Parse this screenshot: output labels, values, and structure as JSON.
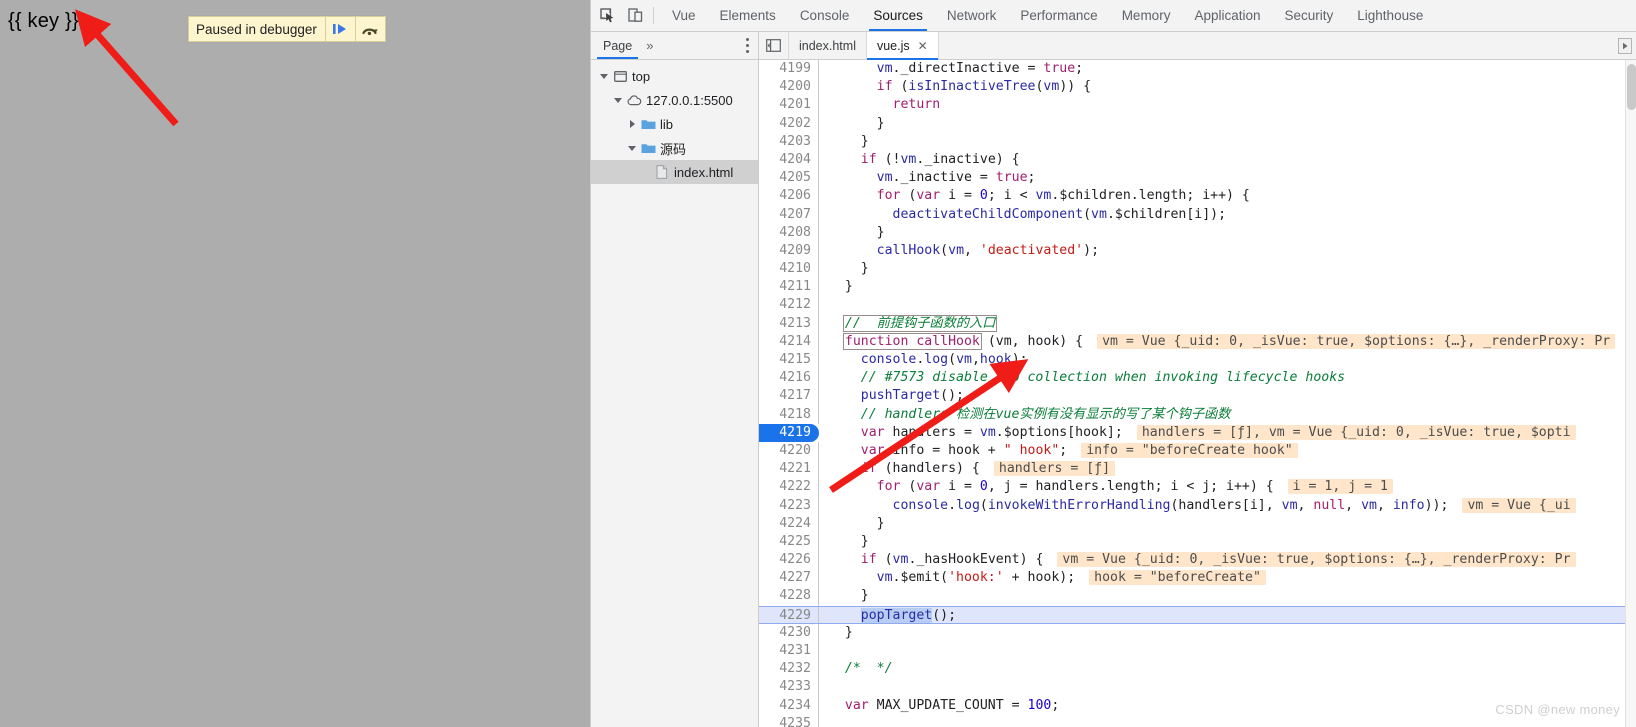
{
  "theme": {
    "accent": "#1a73e8",
    "banner_bg": "#fdf5cd",
    "inline_value_bg": "#ffe5c9",
    "exec_line_bg": "#dfe6fb"
  },
  "page": {
    "body_text": "{{ key }}",
    "paused_banner": {
      "text": "Paused in debugger",
      "resume_icon": "resume-script-icon",
      "step_over_icon": "step-over-icon"
    }
  },
  "devtools": {
    "toolbar_icons": [
      {
        "name": "inspect-element-icon"
      },
      {
        "name": "device-toolbar-icon"
      }
    ],
    "tabs": [
      {
        "label": "Vue",
        "selected": false
      },
      {
        "label": "Elements",
        "selected": false
      },
      {
        "label": "Console",
        "selected": false
      },
      {
        "label": "Sources",
        "selected": true
      },
      {
        "label": "Network",
        "selected": false
      },
      {
        "label": "Performance",
        "selected": false
      },
      {
        "label": "Memory",
        "selected": false
      },
      {
        "label": "Application",
        "selected": false
      },
      {
        "label": "Security",
        "selected": false
      },
      {
        "label": "Lighthouse",
        "selected": false
      }
    ],
    "navigator": {
      "tabs": [
        {
          "label": "Page",
          "selected": true
        }
      ],
      "more_label": "»",
      "tree": [
        {
          "label": "top",
          "depth": 0,
          "icon": "frame-icon",
          "arrow": "open",
          "selected": false
        },
        {
          "label": "127.0.0.1:5500",
          "depth": 1,
          "icon": "cloud-icon",
          "arrow": "open",
          "selected": false
        },
        {
          "label": "lib",
          "depth": 2,
          "icon": "folder-icon",
          "arrow": "closed",
          "selected": false
        },
        {
          "label": "源码",
          "depth": 2,
          "icon": "folder-icon",
          "arrow": "open",
          "selected": false
        },
        {
          "label": "index.html",
          "depth": 3,
          "icon": "file-icon",
          "arrow": "none",
          "selected": true
        }
      ]
    },
    "editor_tabs": [
      {
        "label": "index.html",
        "selected": false,
        "closable": false
      },
      {
        "label": "vue.js",
        "selected": true,
        "closable": true,
        "close_label": "✕"
      }
    ],
    "panel_toggle_icon": "show-navigator-icon",
    "tab_scroll_icon": "scroll-tabs-right-icon"
  },
  "code": {
    "first_line": 4199,
    "execution_line": 4219,
    "current_highlight_line": 4229,
    "lines": [
      {
        "n": 4199,
        "tokens": [
          {
            "t": "      ",
            "c": "pl"
          },
          {
            "t": "vm",
            "c": "nm"
          },
          {
            "t": "._directInactive = ",
            "c": "pl"
          },
          {
            "t": "true",
            "c": "kw"
          },
          {
            "t": ";",
            "c": "pl"
          }
        ]
      },
      {
        "n": 4200,
        "tokens": [
          {
            "t": "      ",
            "c": "pl"
          },
          {
            "t": "if",
            "c": "kw"
          },
          {
            "t": " (",
            "c": "pl"
          },
          {
            "t": "isInInactiveTree",
            "c": "fn"
          },
          {
            "t": "(",
            "c": "pl"
          },
          {
            "t": "vm",
            "c": "nm"
          },
          {
            "t": ")) {",
            "c": "pl"
          }
        ]
      },
      {
        "n": 4201,
        "tokens": [
          {
            "t": "        ",
            "c": "pl"
          },
          {
            "t": "return",
            "c": "kw"
          }
        ]
      },
      {
        "n": 4202,
        "tokens": [
          {
            "t": "      }",
            "c": "pl"
          }
        ]
      },
      {
        "n": 4203,
        "tokens": [
          {
            "t": "    }",
            "c": "pl"
          }
        ]
      },
      {
        "n": 4204,
        "tokens": [
          {
            "t": "    ",
            "c": "pl"
          },
          {
            "t": "if",
            "c": "kw"
          },
          {
            "t": " (!",
            "c": "pl"
          },
          {
            "t": "vm",
            "c": "nm"
          },
          {
            "t": "._inactive) {",
            "c": "pl"
          }
        ]
      },
      {
        "n": 4205,
        "tokens": [
          {
            "t": "      ",
            "c": "pl"
          },
          {
            "t": "vm",
            "c": "nm"
          },
          {
            "t": "._inactive = ",
            "c": "pl"
          },
          {
            "t": "true",
            "c": "kw"
          },
          {
            "t": ";",
            "c": "pl"
          }
        ]
      },
      {
        "n": 4206,
        "tokens": [
          {
            "t": "      ",
            "c": "pl"
          },
          {
            "t": "for",
            "c": "kw"
          },
          {
            "t": " (",
            "c": "pl"
          },
          {
            "t": "var",
            "c": "kw"
          },
          {
            "t": " i = ",
            "c": "pl"
          },
          {
            "t": "0",
            "c": "num"
          },
          {
            "t": "; i < ",
            "c": "pl"
          },
          {
            "t": "vm",
            "c": "nm"
          },
          {
            "t": ".$children.length; i++) {",
            "c": "pl"
          }
        ]
      },
      {
        "n": 4207,
        "tokens": [
          {
            "t": "        ",
            "c": "pl"
          },
          {
            "t": "deactivateChildComponent",
            "c": "fn"
          },
          {
            "t": "(",
            "c": "pl"
          },
          {
            "t": "vm",
            "c": "nm"
          },
          {
            "t": ".$children[i]);",
            "c": "pl"
          }
        ]
      },
      {
        "n": 4208,
        "tokens": [
          {
            "t": "      }",
            "c": "pl"
          }
        ]
      },
      {
        "n": 4209,
        "tokens": [
          {
            "t": "      ",
            "c": "pl"
          },
          {
            "t": "callHook",
            "c": "fn"
          },
          {
            "t": "(",
            "c": "pl"
          },
          {
            "t": "vm",
            "c": "nm"
          },
          {
            "t": ", ",
            "c": "pl"
          },
          {
            "t": "'deactivated'",
            "c": "str"
          },
          {
            "t": ");",
            "c": "pl"
          }
        ]
      },
      {
        "n": 4210,
        "tokens": [
          {
            "t": "    }",
            "c": "pl"
          }
        ]
      },
      {
        "n": 4211,
        "tokens": [
          {
            "t": "  }",
            "c": "pl"
          }
        ]
      },
      {
        "n": 4212,
        "tokens": []
      },
      {
        "n": 4213,
        "tokens": [
          {
            "t": "  ",
            "c": "pl"
          },
          {
            "t": "//  前提钩子函数的入口",
            "c": "cm",
            "box": true
          }
        ]
      },
      {
        "n": 4214,
        "tokens": [
          {
            "t": "  ",
            "c": "pl"
          },
          {
            "t": "function callHook",
            "c": "kw",
            "box": true
          },
          {
            "t": " (vm, hook) {",
            "c": "pl"
          }
        ],
        "inline": "vm = Vue {_uid: 0, _isVue: true, $options: {…}, _renderProxy: Pr"
      },
      {
        "n": 4215,
        "tokens": [
          {
            "t": "    ",
            "c": "pl"
          },
          {
            "t": "console",
            "c": "nm"
          },
          {
            "t": ".",
            "c": "pl"
          },
          {
            "t": "log",
            "c": "fn"
          },
          {
            "t": "(",
            "c": "pl"
          },
          {
            "t": "vm",
            "c": "nm"
          },
          {
            "t": ",",
            "c": "pl"
          },
          {
            "t": "hook",
            "c": "nm"
          },
          {
            "t": ");",
            "c": "pl"
          }
        ]
      },
      {
        "n": 4216,
        "tokens": [
          {
            "t": "    ",
            "c": "pl"
          },
          {
            "t": "// #7573 disable dep collection when invoking lifecycle hooks",
            "c": "cm"
          }
        ]
      },
      {
        "n": 4217,
        "tokens": [
          {
            "t": "    ",
            "c": "pl"
          },
          {
            "t": "pushTarget",
            "c": "fn"
          },
          {
            "t": "();",
            "c": "pl"
          }
        ]
      },
      {
        "n": 4218,
        "tokens": [
          {
            "t": "    ",
            "c": "pl"
          },
          {
            "t": "// handlers 检测在vue实例有没有显示的写了某个钩子函数",
            "c": "cm"
          }
        ]
      },
      {
        "n": 4219,
        "tokens": [
          {
            "t": "    ",
            "c": "pl"
          },
          {
            "t": "var",
            "c": "kw"
          },
          {
            "t": " handlers = ",
            "c": "pl"
          },
          {
            "t": "vm",
            "c": "nm"
          },
          {
            "t": ".$options[hook];",
            "c": "pl"
          }
        ],
        "inline": "handlers = [ƒ], vm = Vue {_uid: 0, _isVue: true, $opti"
      },
      {
        "n": 4220,
        "tokens": [
          {
            "t": "    ",
            "c": "pl"
          },
          {
            "t": "var",
            "c": "kw"
          },
          {
            "t": " info = hook + ",
            "c": "pl"
          },
          {
            "t": "\" hook\"",
            "c": "str"
          },
          {
            "t": ";",
            "c": "pl"
          }
        ],
        "inline": "info = \"beforeCreate hook\""
      },
      {
        "n": 4221,
        "tokens": [
          {
            "t": "    ",
            "c": "pl"
          },
          {
            "t": "if",
            "c": "kw"
          },
          {
            "t": " (handlers) {",
            "c": "pl"
          }
        ],
        "inline": "handlers = [ƒ]"
      },
      {
        "n": 4222,
        "tokens": [
          {
            "t": "      ",
            "c": "pl"
          },
          {
            "t": "for",
            "c": "kw"
          },
          {
            "t": " (",
            "c": "pl"
          },
          {
            "t": "var",
            "c": "kw"
          },
          {
            "t": " i = ",
            "c": "pl"
          },
          {
            "t": "0",
            "c": "num"
          },
          {
            "t": ", j = handlers.length; i < j; i++) {",
            "c": "pl"
          }
        ],
        "inline": "i = 1, j = 1"
      },
      {
        "n": 4223,
        "tokens": [
          {
            "t": "        ",
            "c": "pl"
          },
          {
            "t": "console",
            "c": "nm"
          },
          {
            "t": ".",
            "c": "pl"
          },
          {
            "t": "log",
            "c": "fn"
          },
          {
            "t": "(",
            "c": "pl"
          },
          {
            "t": "invokeWithErrorHandling",
            "c": "fn"
          },
          {
            "t": "(handlers[i], ",
            "c": "pl"
          },
          {
            "t": "vm",
            "c": "nm"
          },
          {
            "t": ", ",
            "c": "pl"
          },
          {
            "t": "null",
            "c": "kw"
          },
          {
            "t": ", ",
            "c": "pl"
          },
          {
            "t": "vm",
            "c": "nm"
          },
          {
            "t": ", ",
            "c": "pl"
          },
          {
            "t": "info",
            "c": "nm"
          },
          {
            "t": "));",
            "c": "pl"
          }
        ],
        "inline": "vm = Vue {_ui"
      },
      {
        "n": 4224,
        "tokens": [
          {
            "t": "      }",
            "c": "pl"
          }
        ]
      },
      {
        "n": 4225,
        "tokens": [
          {
            "t": "    }",
            "c": "pl"
          }
        ]
      },
      {
        "n": 4226,
        "tokens": [
          {
            "t": "    ",
            "c": "pl"
          },
          {
            "t": "if",
            "c": "kw"
          },
          {
            "t": " (",
            "c": "pl"
          },
          {
            "t": "vm",
            "c": "nm"
          },
          {
            "t": "._hasHookEvent) {",
            "c": "pl"
          }
        ],
        "inline": "vm = Vue {_uid: 0, _isVue: true, $options: {…}, _renderProxy: Pr"
      },
      {
        "n": 4227,
        "tokens": [
          {
            "t": "      ",
            "c": "pl"
          },
          {
            "t": "vm",
            "c": "nm"
          },
          {
            "t": ".$emit(",
            "c": "pl"
          },
          {
            "t": "'hook:'",
            "c": "str"
          },
          {
            "t": " + hook);",
            "c": "pl"
          }
        ],
        "inline": "hook = \"beforeCreate\""
      },
      {
        "n": 4228,
        "tokens": [
          {
            "t": "    }",
            "c": "pl"
          }
        ]
      },
      {
        "n": 4229,
        "tokens": [
          {
            "t": "    ",
            "c": "pl"
          },
          {
            "t": "popTarget",
            "c": "fn",
            "sel": true
          },
          {
            "t": "();",
            "c": "pl"
          }
        ]
      },
      {
        "n": 4230,
        "tokens": [
          {
            "t": "  }",
            "c": "pl"
          }
        ]
      },
      {
        "n": 4231,
        "tokens": []
      },
      {
        "n": 4232,
        "tokens": [
          {
            "t": "  ",
            "c": "pl"
          },
          {
            "t": "/*  */",
            "c": "cm"
          }
        ]
      },
      {
        "n": 4233,
        "tokens": []
      },
      {
        "n": 4234,
        "tokens": [
          {
            "t": "  ",
            "c": "pl"
          },
          {
            "t": "var",
            "c": "kw"
          },
          {
            "t": " MAX_UPDATE_COUNT = ",
            "c": "pl"
          },
          {
            "t": "100",
            "c": "num"
          },
          {
            "t": ";",
            "c": "pl"
          }
        ]
      },
      {
        "n": 4235,
        "tokens": []
      }
    ]
  },
  "watermark": "CSDN @new money",
  "annotations": {
    "arrow1": {
      "name": "red-arrow-to-page-text"
    },
    "arrow2": {
      "name": "red-arrow-to-code-line"
    }
  }
}
